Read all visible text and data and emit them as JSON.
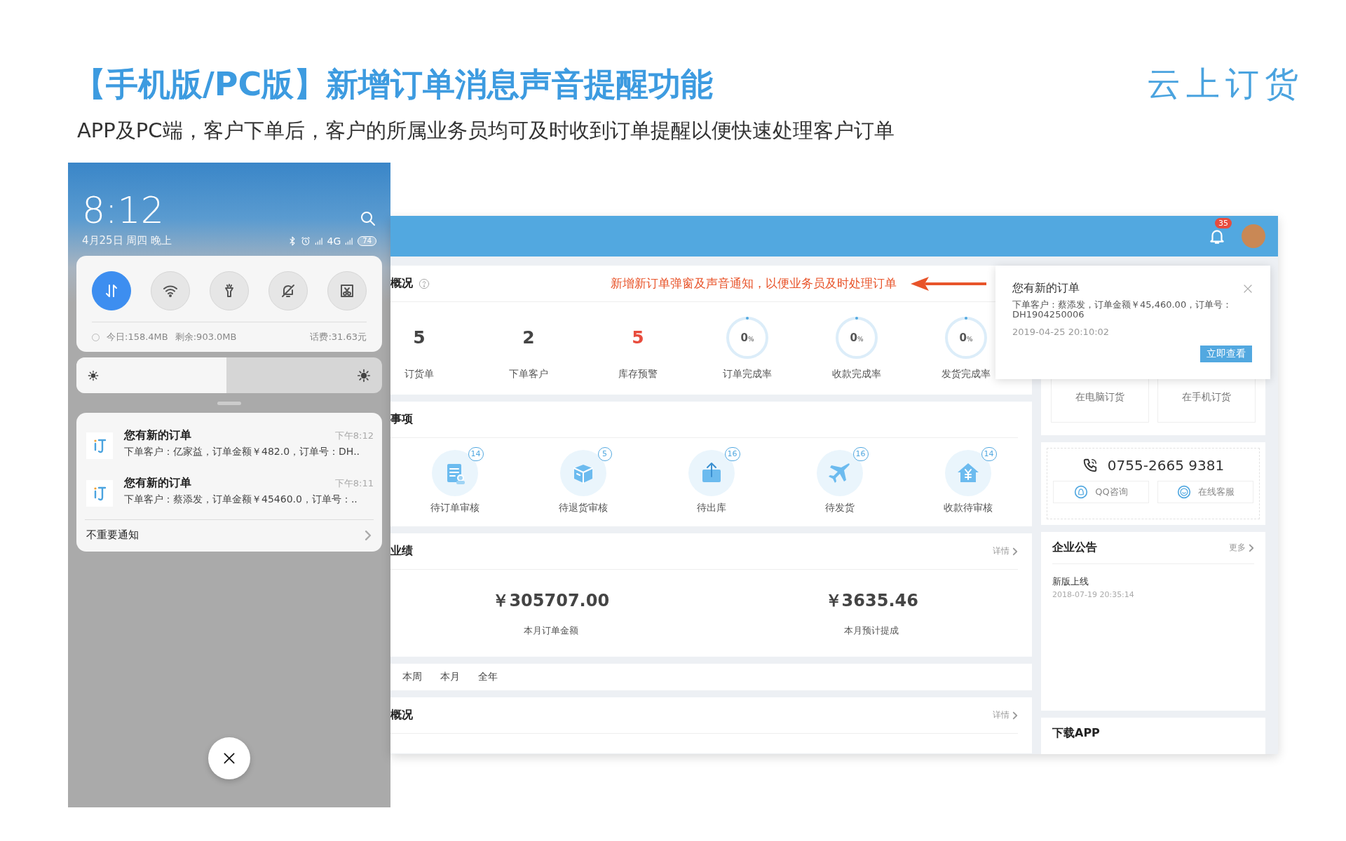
{
  "header": {
    "title": "【手机版/PC版】新增订单消息声音提醒功能",
    "logo": "云上订货",
    "subtitle": "APP及PC端，客户下单后，客户的所属业务员均可及时收到订单提醒以便快速处理客户订单"
  },
  "phone": {
    "time": "8:12",
    "date": "4月25日 周四 晚上",
    "network": "4G",
    "battery": "74",
    "toggles": [
      {
        "kind": "data",
        "on": true
      },
      {
        "kind": "wifi",
        "on": false
      },
      {
        "kind": "flashlight",
        "on": false
      },
      {
        "kind": "mute",
        "on": false
      },
      {
        "kind": "screenshot",
        "on": false
      }
    ],
    "usage_today": "今日:158.4MB",
    "usage_left": "剩余:903.0MB",
    "balance": "话费:31.63元",
    "brightness": {
      "level": 0.49
    },
    "notifications": [
      {
        "title": "您有新的订单",
        "time": "下午8:12",
        "text": "下单客户：亿家益，订单金额￥482.0，订单号：DH.."
      },
      {
        "title": "您有新的订单",
        "time": "下午8:11",
        "text": "下单客户：蔡添发，订单金额￥45460.0，订单号：.."
      }
    ],
    "folded_label": "不重要通知"
  },
  "pc": {
    "bell_badge": "35",
    "overview": {
      "title": "概况",
      "annotation": "新增新订单弹窗及声音通知，以便业务员及时处理订单",
      "stats": [
        {
          "kind": "number",
          "value": "5",
          "label": "订货单",
          "alert": false
        },
        {
          "kind": "number",
          "value": "2",
          "label": "下单客户",
          "alert": false
        },
        {
          "kind": "number",
          "value": "5",
          "label": "库存预警",
          "alert": true
        },
        {
          "kind": "ring",
          "value": "0",
          "unit": "%",
          "label": "订单完成率",
          "level": 0
        },
        {
          "kind": "ring",
          "value": "0",
          "unit": "%",
          "label": "收款完成率",
          "level": 0
        },
        {
          "kind": "ring",
          "value": "0",
          "unit": "%",
          "label": "发货完成率",
          "level": 0
        }
      ]
    },
    "todo": {
      "title": "事项",
      "items": [
        {
          "kind": "order",
          "count": "14",
          "label": "待订单审核"
        },
        {
          "kind": "return",
          "count": "5",
          "label": "待退货审核"
        },
        {
          "kind": "outbound",
          "count": "16",
          "label": "待出库"
        },
        {
          "kind": "shipping",
          "count": "16",
          "label": "待发货"
        },
        {
          "kind": "payment",
          "count": "14",
          "label": "收款待审核"
        }
      ]
    },
    "performance": {
      "title": "业绩",
      "link": "详情",
      "figures": [
        {
          "value": "￥305707.00",
          "label": "本月订单金额"
        },
        {
          "value": "￥3635.46",
          "label": "本月预计提成"
        }
      ]
    },
    "periods": [
      {
        "label": "本周",
        "selected": false
      },
      {
        "label": "本月",
        "selected": false
      },
      {
        "label": "全年",
        "selected": false
      }
    ],
    "overview_bottom": {
      "title": "概况",
      "link": "详情"
    },
    "order_channels": [
      "在电脑订货",
      "在手机订货"
    ],
    "hotline": {
      "number": "0755-2665 9381",
      "buttons": [
        {
          "kind": "qq",
          "label": "QQ咨询"
        },
        {
          "kind": "service",
          "label": "在线客服"
        }
      ]
    },
    "notices": {
      "title": "企业公告",
      "more": "更多",
      "items": [
        {
          "title": "新版上线",
          "time": "2018-07-19 20:35:14"
        }
      ]
    },
    "download": {
      "title": "下载APP"
    },
    "popup": {
      "title": "您有新的订单",
      "text": "下单客户：蔡添发，订单金额￥45,460.00，订单号：DH1904250006",
      "time": "2019-04-25 20:10:02",
      "button": "立即查看"
    }
  }
}
